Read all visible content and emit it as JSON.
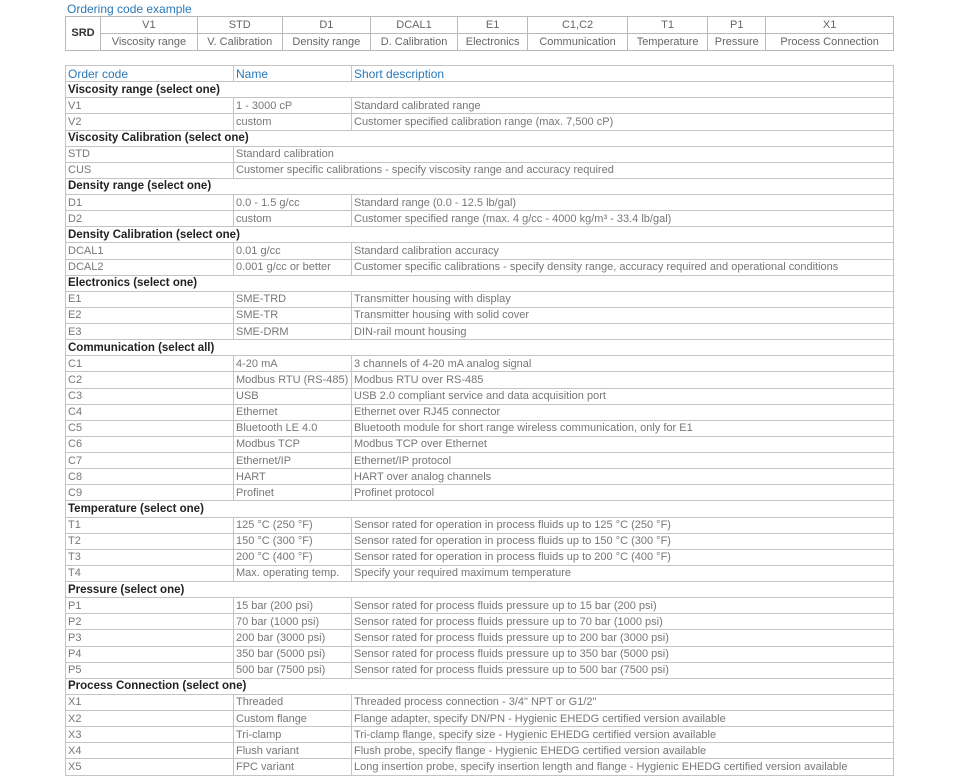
{
  "example": {
    "title": "Ordering code example",
    "prefix": "SRD",
    "codes": [
      {
        "code": "V1",
        "label": "Viscosity range"
      },
      {
        "code": "STD",
        "label": "V. Calibration"
      },
      {
        "code": "D1",
        "label": "Density range"
      },
      {
        "code": "DCAL1",
        "label": "D. Calibration"
      },
      {
        "code": "E1",
        "label": "Electronics"
      },
      {
        "code": "C1,C2",
        "label": "Communication"
      },
      {
        "code": "T1",
        "label": "Temperature"
      },
      {
        "code": "P1",
        "label": "Pressure"
      },
      {
        "code": "X1",
        "label": "Process Connection"
      }
    ]
  },
  "table": {
    "headers": [
      "Order code",
      "Name",
      "Short description"
    ],
    "sections": [
      {
        "title": "Viscosity range (select one)",
        "rows": [
          [
            "V1",
            "1 - 3000 cP",
            "Standard calibrated range"
          ],
          [
            "V2",
            "custom",
            "Customer specified calibration range (max. 7,500 cP)"
          ]
        ]
      },
      {
        "title": "Viscosity Calibration (select one)",
        "rows": [
          [
            "STD",
            "Standard calibration",
            ""
          ],
          [
            "CUS",
            "Customer specific calibrations - specify viscosity range and accuracy required",
            ""
          ]
        ]
      },
      {
        "title": "Density range (select one)",
        "rows": [
          [
            "D1",
            "0.0 - 1.5 g/cc",
            "Standard range (0.0 - 12.5 lb/gal)"
          ],
          [
            "D2",
            "custom",
            "Customer specified range  (max. 4 g/cc - 4000 kg/m³ - 33.4 lb/gal)"
          ]
        ]
      },
      {
        "title": "Density Calibration (select one)",
        "rows": [
          [
            "DCAL1",
            "0.01 g/cc",
            "Standard calibration accuracy"
          ],
          [
            "DCAL2",
            "0.001 g/cc or better",
            "Customer specific calibrations - specify density range, accuracy required and operational conditions"
          ]
        ]
      },
      {
        "title": "Electronics (select one)",
        "rows": [
          [
            "E1",
            "SME-TRD",
            "Transmitter housing with display"
          ],
          [
            "E2",
            "SME-TR",
            "Transmitter housing with solid cover"
          ],
          [
            "E3",
            "SME-DRM",
            "DIN-rail mount housing"
          ]
        ]
      },
      {
        "title": "Communication (select all)",
        "rows": [
          [
            "C1",
            "4-20 mA",
            "3 channels of 4-20 mA analog signal"
          ],
          [
            "C2",
            "Modbus RTU (RS-485)",
            "Modbus RTU over RS-485"
          ],
          [
            "C3",
            "USB",
            "USB 2.0 compliant service and data acquisition port"
          ],
          [
            "C4",
            "Ethernet",
            "Ethernet over RJ45 connector"
          ],
          [
            "C5",
            "Bluetooth LE 4.0",
            "Bluetooth module for short range wireless communication, only for E1"
          ],
          [
            "C6",
            "Modbus TCP",
            "Modbus TCP over Ethernet"
          ],
          [
            "C7",
            "Ethernet/IP",
            "Ethernet/IP protocol"
          ],
          [
            "C8",
            "HART",
            "HART over analog channels"
          ],
          [
            "C9",
            "Profinet",
            "Profinet protocol"
          ]
        ]
      },
      {
        "title": "Temperature (select one)",
        "rows": [
          [
            "T1",
            "125 °C (250 °F)",
            "Sensor rated for operation in process fluids up to 125 °C (250 °F)"
          ],
          [
            "T2",
            "150 °C (300 °F)",
            "Sensor rated for operation in process fluids up to 150 °C (300 °F)"
          ],
          [
            "T3",
            "200 °C (400 °F)",
            "Sensor rated for operation in process fluids up to 200 °C (400 °F)"
          ],
          [
            "T4",
            "Max. operating temp.",
            "Specify your required maximum temperature"
          ]
        ]
      },
      {
        "title": "Pressure (select one)",
        "rows": [
          [
            "P1",
            "15 bar (200 psi)",
            "Sensor rated for process fluids pressure up to 15 bar (200 psi)"
          ],
          [
            "P2",
            "70 bar (1000 psi)",
            "Sensor rated for process fluids pressure up to 70 bar (1000 psi)"
          ],
          [
            "P3",
            "200 bar (3000 psi)",
            "Sensor rated for process fluids pressure up to 200 bar (3000 psi)"
          ],
          [
            "P4",
            "350 bar (5000 psi)",
            "Sensor rated for process fluids pressure up to 350 bar (5000 psi)"
          ],
          [
            "P5",
            "500 bar (7500 psi)",
            "Sensor rated for process fluids pressure up to 500 bar (7500 psi)"
          ]
        ]
      },
      {
        "title": "Process Connection (select one)",
        "rows": [
          [
            "X1",
            "Threaded",
            "Threaded process connection - 3/4\" NPT or G1/2\""
          ],
          [
            "X2",
            "Custom flange",
            "Flange adapter, specify DN/PN - Hygienic EHEDG certified version available"
          ],
          [
            "X3",
            "Tri-clamp",
            "Tri-clamp flange, specify size - Hygienic EHEDG certified version available"
          ],
          [
            "X4",
            "Flush variant",
            "Flush probe, specify flange - Hygienic EHEDG certified version available"
          ],
          [
            "X5",
            "FPC variant",
            "Long insertion probe, specify insertion length and flange - Hygienic EHEDG certified version available"
          ]
        ]
      }
    ]
  }
}
